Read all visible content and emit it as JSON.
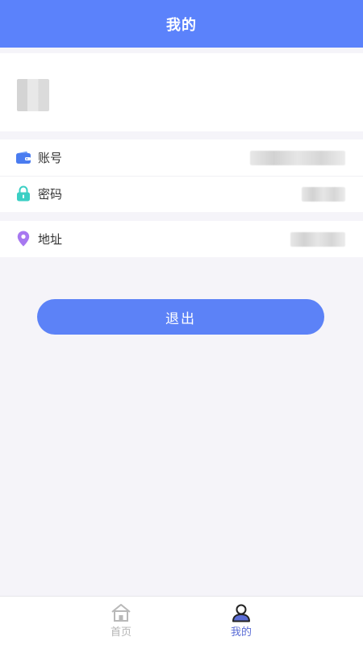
{
  "header": {
    "title": "我的"
  },
  "profile": {
    "avatar": "blurred-avatar"
  },
  "account_group": {
    "items": [
      {
        "label": "账号",
        "icon": "wallet-icon",
        "icon_color": "#4a7cf0",
        "value_blurred": true
      },
      {
        "label": "密码",
        "icon": "lock-icon",
        "icon_color": "#3bcfc4",
        "value_blurred": true
      }
    ]
  },
  "address_group": {
    "items": [
      {
        "label": "地址",
        "icon": "location-pin-icon",
        "icon_color": "#a778f0",
        "value_blurred": true
      }
    ]
  },
  "logout": {
    "label": "退出"
  },
  "tabbar": {
    "items": [
      {
        "label": "首页",
        "icon": "home-icon",
        "active": false
      },
      {
        "label": "我的",
        "icon": "user-icon",
        "active": true
      }
    ]
  },
  "colors": {
    "primary": "#5b82fb",
    "page_background": "#f5f4f9",
    "active_tab": "#5b6dd6",
    "inactive_tab": "#b4b4b4"
  }
}
